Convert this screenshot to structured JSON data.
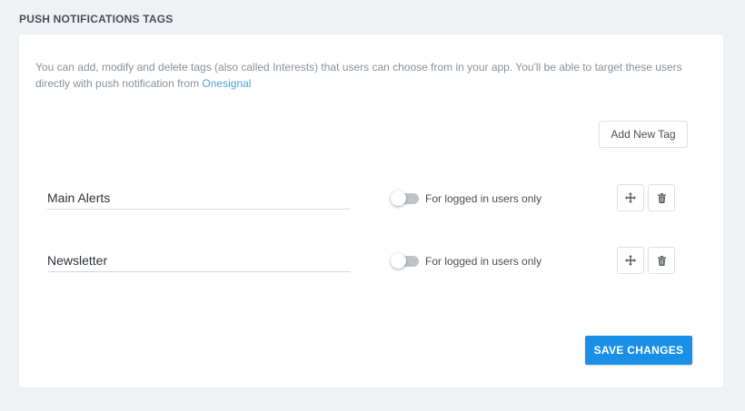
{
  "section": {
    "title": "PUSH NOTIFICATIONS TAGS"
  },
  "description": {
    "text": "You can add, modify and delete tags (also called Interests) that users can choose from in your app. You'll be able to target these users directly with push notification from ",
    "link_text": "Onesignal"
  },
  "add_button": {
    "label": "Add New Tag"
  },
  "tags": [
    {
      "name": "Main Alerts",
      "toggle_label": "For logged in users only",
      "toggle_on": false
    },
    {
      "name": "Newsletter",
      "toggle_label": "For logged in users only",
      "toggle_on": false
    }
  ],
  "icons": {
    "move": "move-arrows-icon",
    "delete": "trash-icon"
  },
  "save_button": {
    "label": "SAVE CHANGES"
  },
  "colors": {
    "accent": "#1a8fe8",
    "link": "#4aa3df",
    "background": "#eef2f5"
  }
}
